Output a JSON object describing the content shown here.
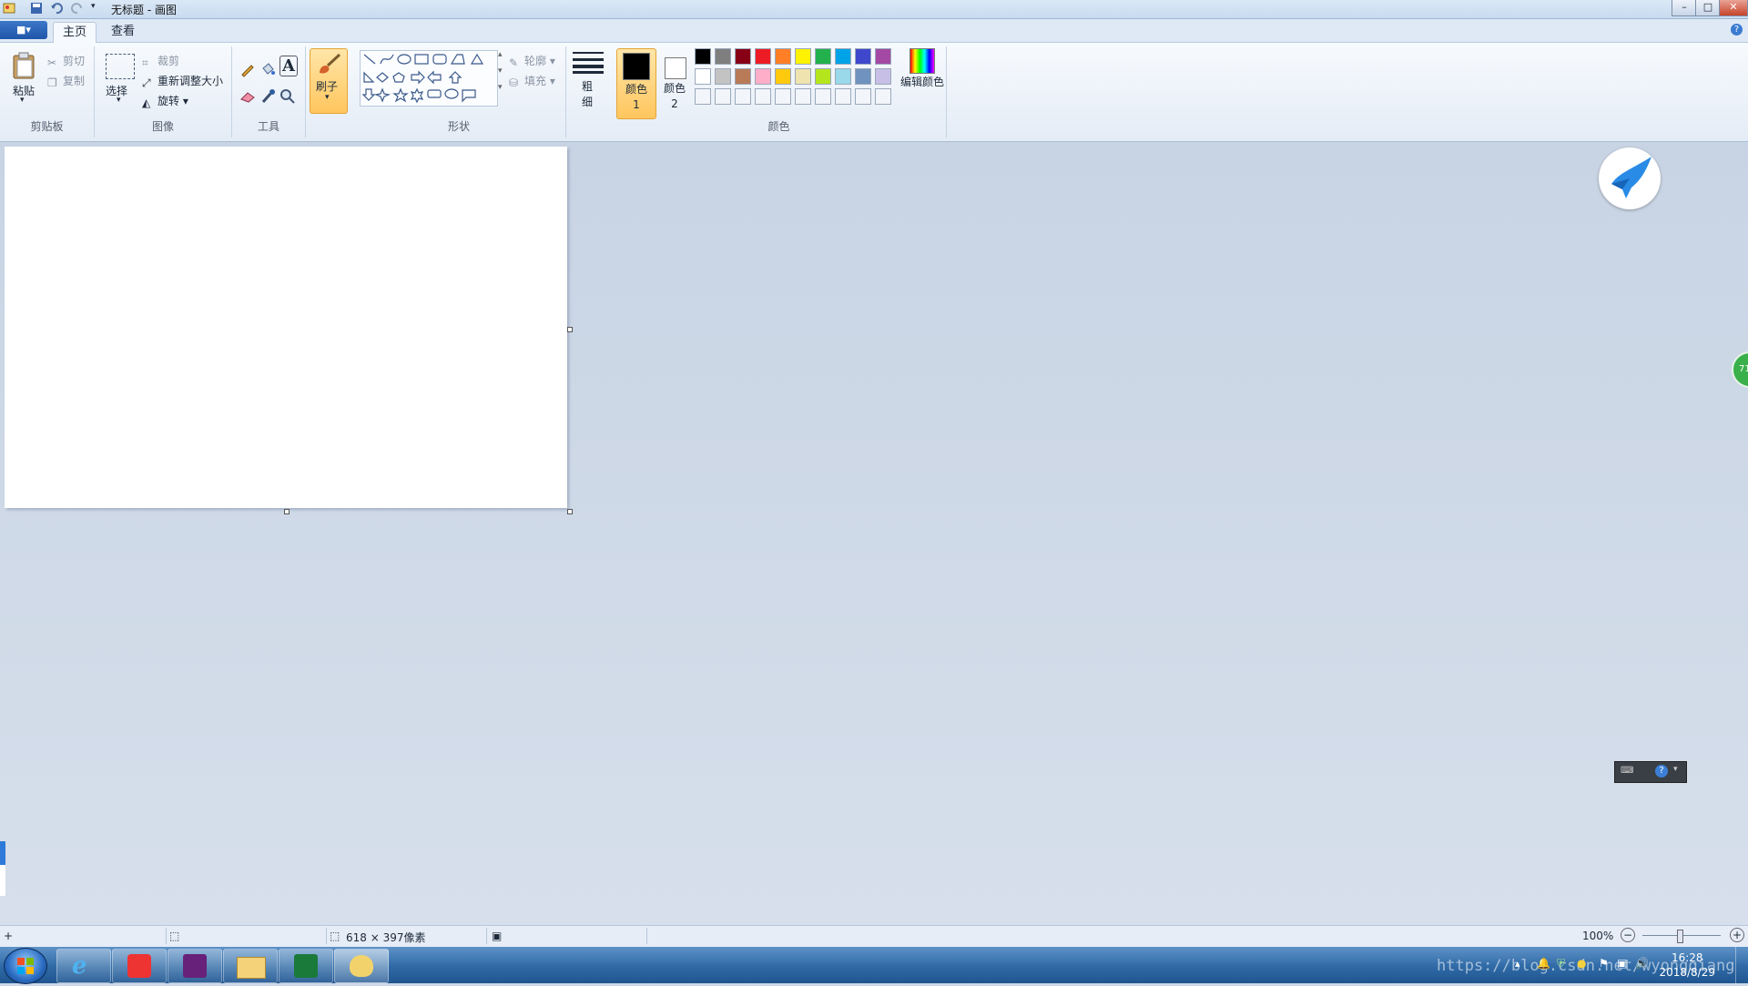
{
  "window": {
    "title": "无标题 - 画图",
    "controls": {
      "minimize": "–",
      "maximize": "□",
      "close": "✕"
    }
  },
  "tabs": {
    "app_menu": "■▾",
    "home": "主页",
    "view": "查看",
    "help": "?"
  },
  "ribbon": {
    "clipboard": {
      "paste": "粘贴",
      "cut": "剪切",
      "copy": "复制",
      "label": "剪贴板"
    },
    "image": {
      "select": "选择",
      "crop": "裁剪",
      "resize": "重新调整大小",
      "rotate": "旋转",
      "label": "图像"
    },
    "tools": {
      "label": "工具"
    },
    "brushes": {
      "label": "刷子"
    },
    "shapes": {
      "outline": "轮廓",
      "fill": "填充",
      "label": "形状"
    },
    "size": {
      "label": "粗细"
    },
    "color1": {
      "label": "颜色 1",
      "color": "#000000"
    },
    "color2": {
      "label": "颜色 2",
      "color": "#ffffff"
    },
    "colors": {
      "label": "颜色",
      "edit": "编辑颜色",
      "palette_row1": [
        "#000000",
        "#7f7f7f",
        "#880015",
        "#ed1c24",
        "#ff7f27",
        "#fff200",
        "#22b14c",
        "#00a2e8",
        "#3f48cc",
        "#a349a4"
      ],
      "palette_row2": [
        "#ffffff",
        "#c3c3c3",
        "#b97a57",
        "#ffaec9",
        "#ffc90e",
        "#efe4b0",
        "#b5e61d",
        "#99d9ea",
        "#7092be",
        "#c8bfe7"
      ]
    }
  },
  "statusbar": {
    "canvas_size": "618 × 397像素",
    "zoom": "100%"
  },
  "taskbar": {
    "time": "16:28",
    "date": "2018/8/29",
    "watermark": "https://blog.csdn.net/wyongqiang"
  },
  "floating": {
    "badge": "71"
  }
}
